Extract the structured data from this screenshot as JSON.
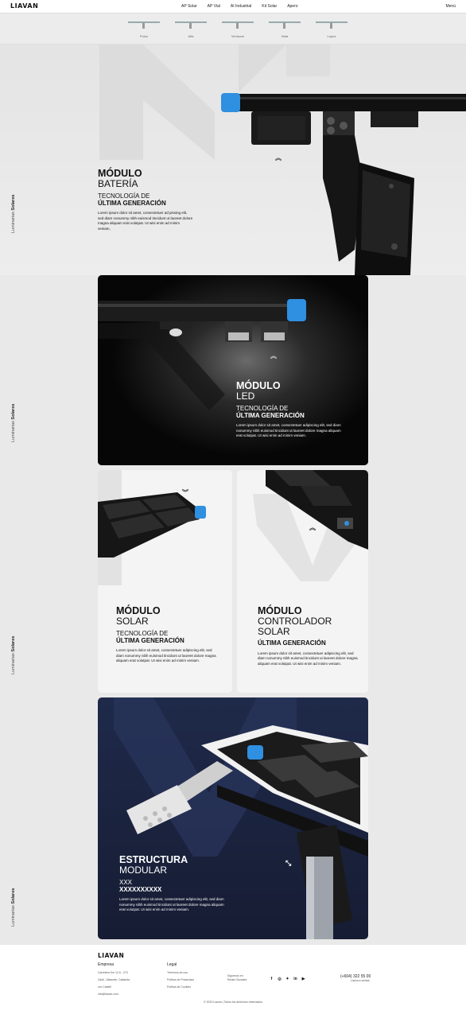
{
  "header": {
    "logo": "LIAVAN",
    "nav": [
      "AP Solar",
      "AP Vial",
      "AI Industrial",
      "Kit Solar",
      "Apero"
    ],
    "menu_label": "Menú"
  },
  "subnav": {
    "items": [
      "Polux",
      "Alfa",
      "Ventuzze",
      "Vista",
      "Lopez"
    ]
  },
  "side_label": {
    "prefix": "Luminarias ",
    "bold": "Solares"
  },
  "modules": {
    "bateria": {
      "title_bold": "MÓDULO",
      "title_light": "BATERÍA",
      "sub1": "TECNOLOGÍA DE",
      "sub2": "ÚLTIMA GENERACIÓN",
      "body": "Lorem ipsum dolor sit amet, consectetuer ad pissing elit, sed diam nonummy nibh euismod tincidunt ut laoreet dolore magna aliquam erat volutpat. Ut wisi enim ad minim veniam,"
    },
    "led": {
      "title_bold": "MÓDULO",
      "title_light": "LED",
      "sub1": "TECNOLOGÍA DE",
      "sub2": "ÚLTIMA GENERACIÓN",
      "body": "Lorem ipsum dolor sit amet, consectetuer adipiscing elit, sed diam nonummy nibh euismod tincidunt ut laoreet dolore magna aliquam erat volutpat. Ut wisi enim ad minim veniam."
    },
    "solar": {
      "title_bold": "MÓDULO",
      "title_light": "SOLAR",
      "sub1": "TECNOLOGÍA DE",
      "sub2": "ÚLTIMA GENERACIÓN",
      "body": "Lorem ipsum dolor sit amet, consectetuer adipiscing elit, sed diam nonummy nibh euismod tincidunt ut laoreet dolore magna aliquam erat volutpat. Ut wisi enim ad minim veniam."
    },
    "controlador": {
      "title_bold": "MÓDULO",
      "title_light": "CONTROLADOR",
      "title_light2": "SOLAR",
      "sub2": "ÚLTIMA GENERACIÓN",
      "body": "Lorem ipsum dolor sit amet, consectetuer adipiscing elit, sed diam nonummy nibh euismod tincidunt ut laoreet dolore magna aliquam erat volutpat. Ut wisi enim ad minim veniam."
    },
    "estructura": {
      "title_bold": "ESTRUCTURA",
      "title_light": "MODULAR",
      "sub1": "XXX",
      "sub2": "XXXXXXXXXX",
      "body": "Lorem ipsum dolor sit amet, consectetuer adipiscing elit, sed diam nonummy nibh euismod tincidunt ut laoreet dolore magna aliquam erat volutpat. Ut wisi enim ad minim veniam."
    }
  },
  "footer": {
    "logo": "LIAVAN",
    "empresa_title": "Empresa",
    "empresa_lines": [
      "Carretera Km 12.6 - 273",
      "Zaidi - Albacete, Cataluña",
      "xxx Castell",
      "info@liavan.com"
    ],
    "legal_title": "Legal",
    "legal_lines": [
      "Términos de uso",
      "Política de Privacidad",
      "Política de Cookies"
    ],
    "follow_lines": [
      "Síguenos en",
      "Redes Sociales"
    ],
    "social_icons": [
      "facebook-icon",
      "instagram-icon",
      "twitter-icon",
      "linkedin-icon",
      "youtube-icon"
    ],
    "phone": "(+604) 322 55 00",
    "phone_sub": "Llama a ventas",
    "copyright": "© 2020 Liavan | Todos los derechos reservados"
  },
  "colors": {
    "accent_blue": "#2f8fe0",
    "dark_card": "#0a0a0a",
    "navy_card": "#1d2440"
  }
}
